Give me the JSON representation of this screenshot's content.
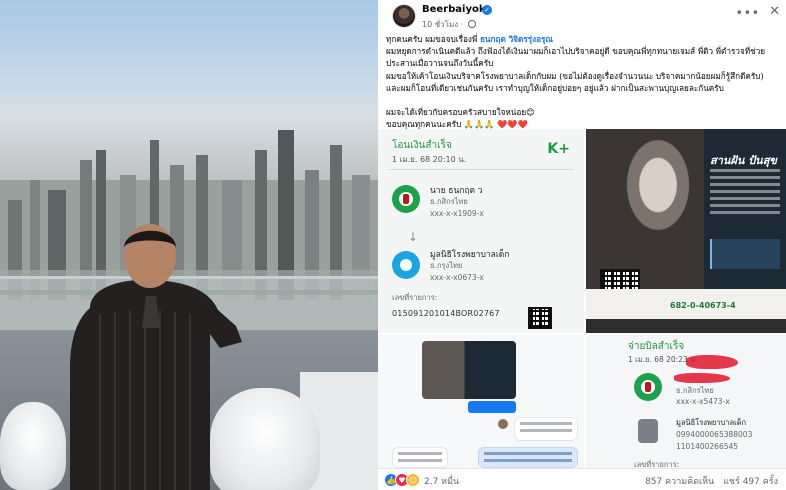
{
  "post": {
    "author": "Beerbaiyoke",
    "time": "10 ชั่วโมง",
    "caption": {
      "line1": "ทุกคนครับ ผมขอจบเรื่องพี่",
      "mention": "ธนกฤต วิจิตรรุ่งอรุณ",
      "line2": "ผมหยุดการดำเนินคดีแล้ว ถึงฟ้องได้เงินมาผมก็เอาไปบริจาคอยู่ดี  ขอบคุณพี่ทุกทนายเจมส์  พี่ติว พี่ตำรวจที่ช่วย",
      "line3": "ประสานเมื่อวานจนถึงวันนี้ครับ",
      "line4": "ผมขอให้เค้าโอนเงินบริจาคโรงพยาบาลเด็กกับผม (ขอไม่ต้องดูเรื่องจำนวนนะ บริจาคมากน้อยผมก็รู้สึกดีครับ)",
      "line5": "และผมก็โอนที่เดียวเช่นกันครับ เราทำบุญให้เด็กอยู่บ่อยๆ อยู่แล้ว ฝากเป็นสะพานบุญเลยละกันครับ",
      "line6": "ผมจะได้เที่ยวกับครอบครัวสบายใจหน่อย😊",
      "line7": "ขอบคุณทุกคนนะครับ 🙏🙏🙏 ❤️❤️❤️"
    }
  },
  "slip1": {
    "header": "โอนเงินสำเร็จ",
    "date": "1 เม.ย. 68  20:10 น.",
    "brand": "K+",
    "from_name": "นาย ธนกฤต ว",
    "from_bank": "ธ.กสิกรไทย",
    "from_acct": "xxx-x-x1909-x",
    "to_name": "มูลนิธิโรงพยาบาลเด็ก",
    "to_bank": "ธ.กรุงไทย",
    "to_acct": "xxx-x-x0673-x",
    "ref_label": "เลขที่รายการ:",
    "ref": "015091201014BOR02767"
  },
  "poster": {
    "title": "สานฝัน ปันสุข",
    "account": "682-0-40673-4"
  },
  "slip2": {
    "header": "จ่ายบิลสำเร็จ",
    "date": "1 เม.ย. 68  20:23 น.",
    "from_bank": "ธ.กสิกรไทย",
    "from_acct": "xxx-x-x5473-x",
    "to_name": "มูลนิธิโรงพยาบาลเด็ก",
    "to_ref1": "0994000065388003",
    "to_ref2": "1101400266545",
    "ref_label": "เลขที่รายการ:"
  },
  "footer": {
    "reactions": "2.7 หมื่น",
    "comments": "857 ความคิดเห็น",
    "shares": "แชร์ 497 ครั้ง"
  },
  "icons": {
    "like": "like-icon",
    "love": "love-icon",
    "care": "care-icon",
    "more": "more-horizontal-icon",
    "close": "close-icon",
    "globe": "globe-icon"
  },
  "colors": {
    "kbank_green": "#1ba24a",
    "link_blue": "#1877f2",
    "love_red": "#f02849"
  }
}
